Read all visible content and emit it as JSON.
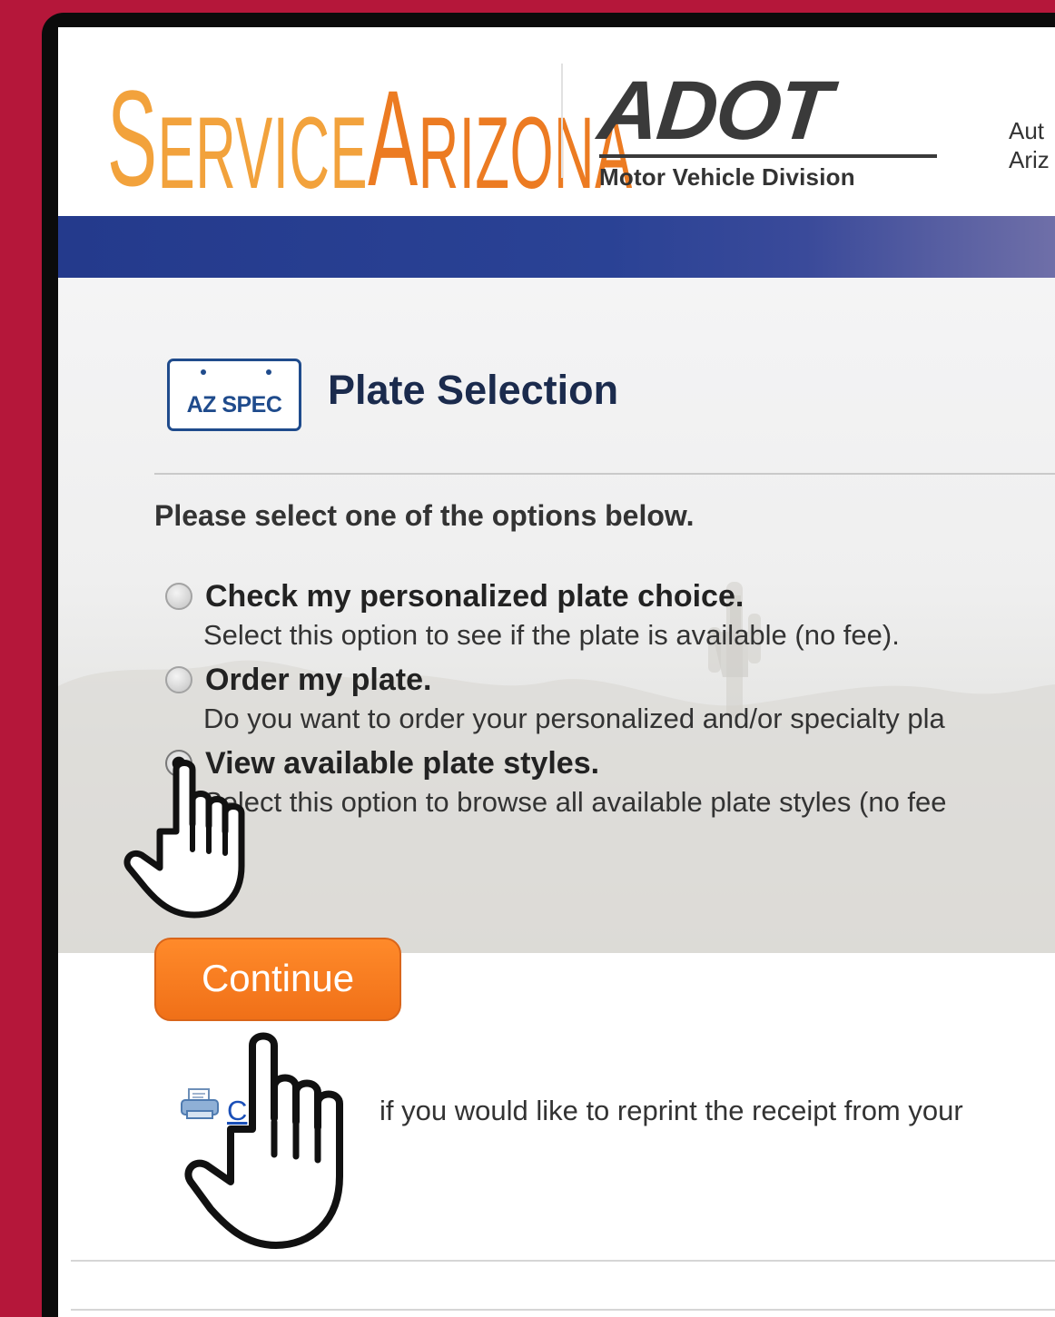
{
  "header": {
    "logo_service": "Service",
    "logo_arizona": "Arizona",
    "adot_wordmark": "ADOT",
    "adot_subtitle": "Motor Vehicle Division",
    "auth_line1": "Aut",
    "auth_line2": "Ariz"
  },
  "page": {
    "icon_text": "AZ SPEC",
    "title": "Plate Selection",
    "instructions": "Please select one of the options below."
  },
  "options": [
    {
      "label": "Check my personalized plate choice.",
      "description": "Select this option to see if the plate is available (no fee).",
      "selected": false
    },
    {
      "label": "Order my plate.",
      "description": "Do you want to order your personalized and/or specialty pla",
      "selected": false
    },
    {
      "label": "View available plate styles.",
      "description": "Select this option to browse all available plate styles (no fee",
      "selected": true
    }
  ],
  "actions": {
    "continue_label": "Continue"
  },
  "reprint": {
    "link_text": "C",
    "text": "if you would like to reprint the receipt from your"
  },
  "icons": {
    "printer": "printer-icon",
    "pointer": "hand-pointer-icon"
  },
  "colors": {
    "frame": "#b5173a",
    "banner": "#2a4295",
    "button": "#f07018",
    "title": "#1b2b4d",
    "logo_service": "#f2a23c",
    "logo_arizona": "#ec7b22"
  }
}
